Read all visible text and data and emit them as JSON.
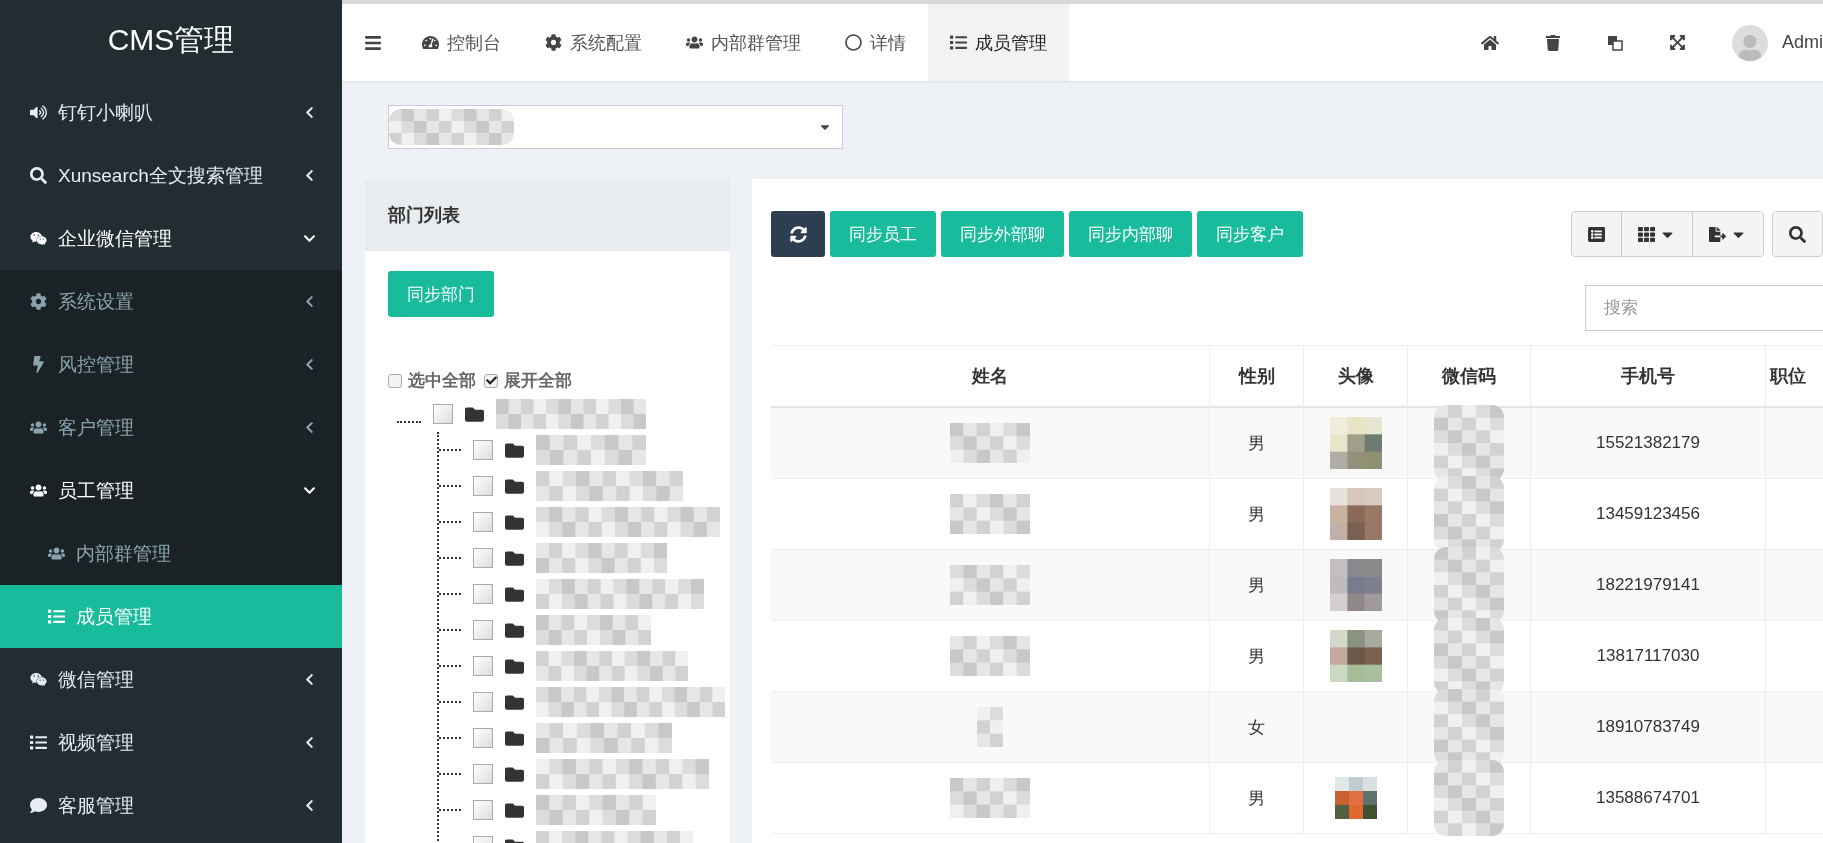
{
  "sidebar": {
    "title": "CMS管理",
    "items": [
      {
        "label": "钉钉小喇叭",
        "expanded": false
      },
      {
        "label": "Xunsearch全文搜索管理",
        "expanded": false
      },
      {
        "label": "企业微信管理",
        "expanded": true,
        "children": [
          {
            "label": "系统设置",
            "expanded": false
          },
          {
            "label": "风控管理",
            "expanded": false
          },
          {
            "label": "客户管理",
            "expanded": false
          },
          {
            "label": "员工管理",
            "expanded": true,
            "children": [
              {
                "label": "内部群管理",
                "selected": false
              },
              {
                "label": "成员管理",
                "selected": true
              }
            ]
          }
        ]
      },
      {
        "label": "微信管理",
        "expanded": false
      },
      {
        "label": "视频管理",
        "expanded": false
      },
      {
        "label": "客服管理",
        "expanded": false
      }
    ]
  },
  "topbar": {
    "tabs": [
      {
        "label": "控制台",
        "selected": false
      },
      {
        "label": "系统配置",
        "selected": false
      },
      {
        "label": "内部群管理",
        "selected": false
      },
      {
        "label": "详情",
        "selected": false
      },
      {
        "label": "成员管理",
        "selected": true
      }
    ],
    "user_name": "Admi"
  },
  "department_panel": {
    "title": "部门列表",
    "sync_button": "同步部门",
    "select_all": {
      "label": "选中全部",
      "checked": false
    },
    "expand_all": {
      "label": "展开全部",
      "checked": true
    },
    "tree": [
      {
        "checked": false,
        "children": [
          {
            "checked": false
          },
          {
            "checked": false
          },
          {
            "checked": false
          },
          {
            "checked": false
          },
          {
            "checked": false
          },
          {
            "checked": false
          },
          {
            "checked": false
          },
          {
            "checked": false
          },
          {
            "checked": false
          },
          {
            "checked": false
          },
          {
            "checked": false
          },
          {
            "checked": false
          }
        ]
      }
    ]
  },
  "members": {
    "buttons": [
      "同步员工",
      "同步外部聊",
      "同步内部聊",
      "同步客户"
    ],
    "search": {
      "placeholder": "搜索"
    },
    "table": {
      "columns": [
        "姓名",
        "性别",
        "头像",
        "微信码",
        "手机号",
        "职位"
      ],
      "rows": [
        {
          "gender": "男",
          "avatar": true,
          "phone": "15521382179"
        },
        {
          "gender": "男",
          "avatar": true,
          "phone": "13459123456"
        },
        {
          "gender": "男",
          "avatar": true,
          "phone": "18221979141"
        },
        {
          "gender": "男",
          "avatar": true,
          "phone": "13817117030"
        },
        {
          "gender": "女",
          "avatar": false,
          "phone": "18910783749"
        },
        {
          "gender": "男",
          "avatar": true,
          "phone": "13588674701"
        }
      ]
    }
  }
}
